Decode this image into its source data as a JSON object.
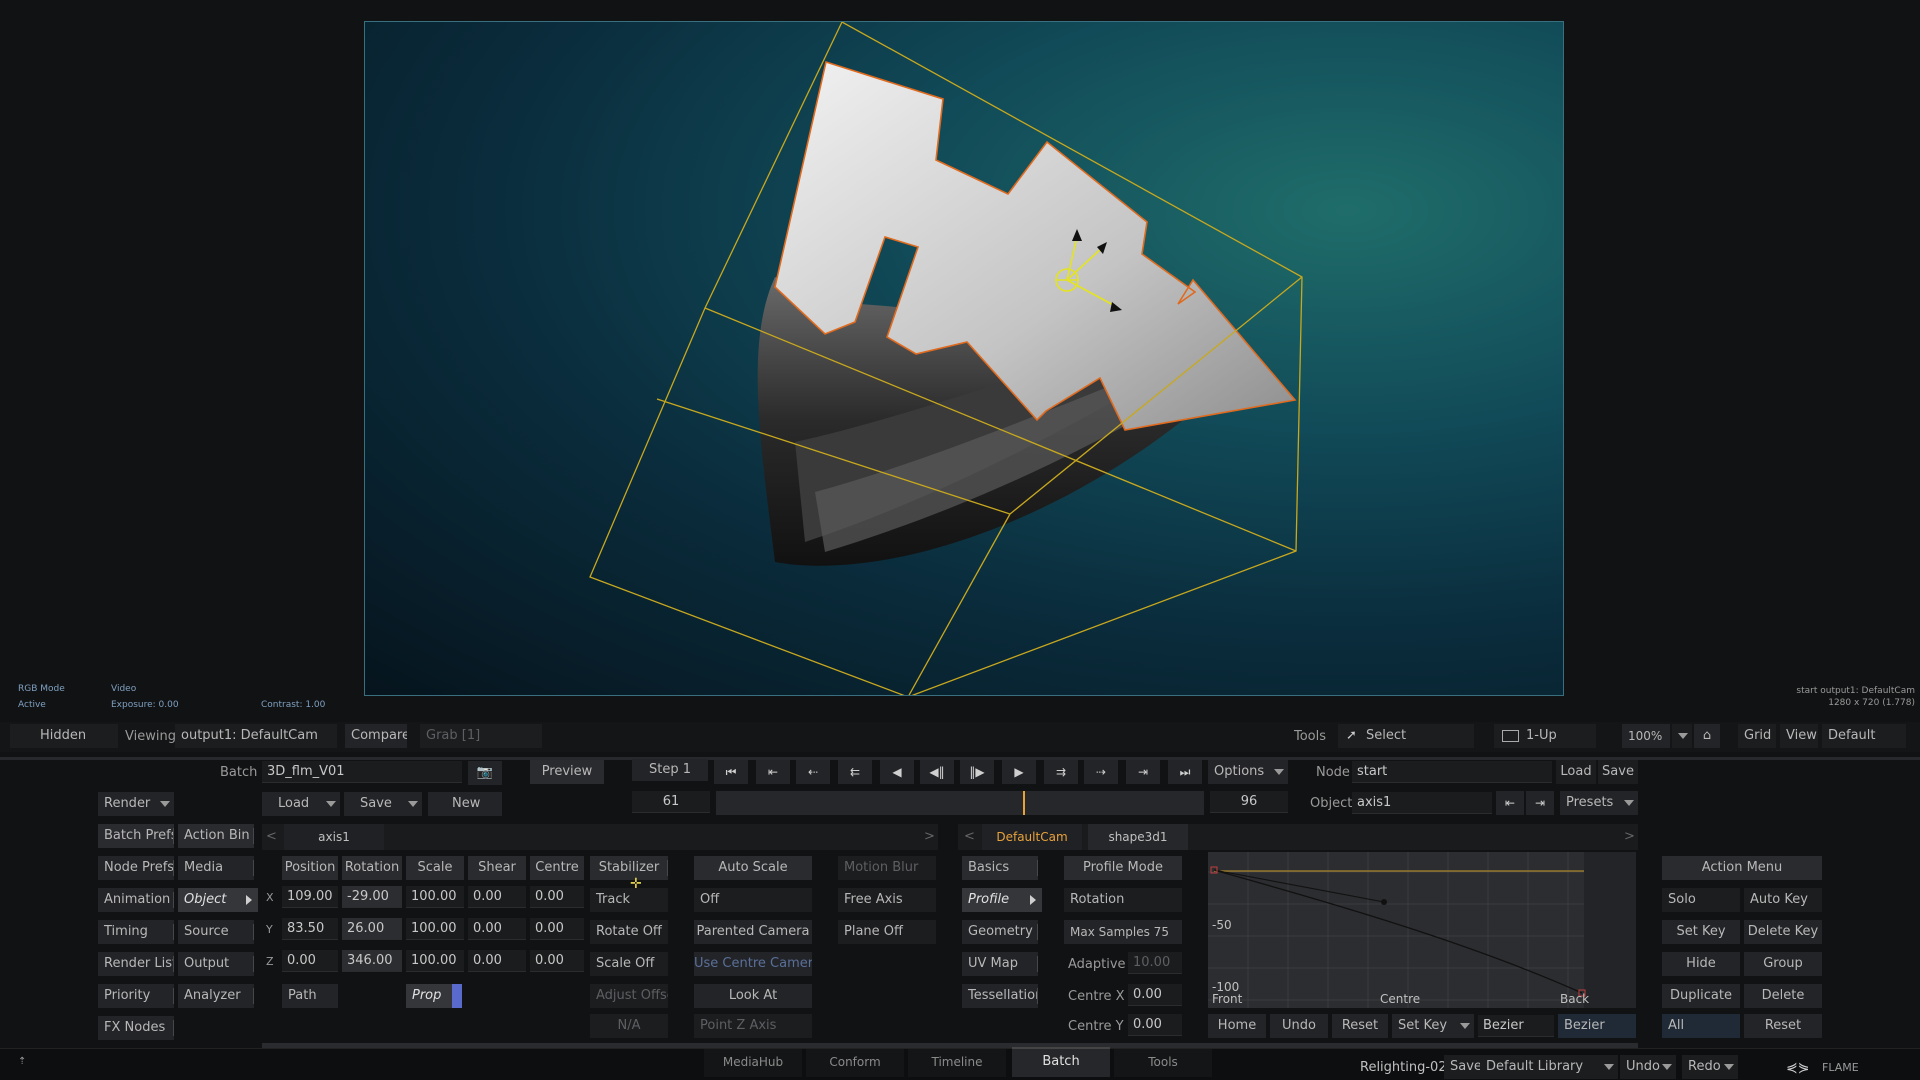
{
  "viewer": {
    "info_left": {
      "rgb_mode": "RGB Mode",
      "active": "Active",
      "video": "Video",
      "exposure": "Exposure: 0.00",
      "contrast": "Contrast: 1.00"
    },
    "info_right": {
      "line1": "start output1: DefaultCam",
      "line2": "1280 x 720 (1.778)"
    }
  },
  "viewbar": {
    "hidden": "Hidden",
    "viewing_label": "Viewing",
    "viewing_value": "output1: DefaultCam",
    "compare": "Compare",
    "grab": "Grab [1]",
    "tools_label": "Tools",
    "select": "Select",
    "layout": "1-Up",
    "zoom": "100%",
    "grid": "Grid",
    "view": "View",
    "default": "Default"
  },
  "batch": {
    "batch_label": "Batch",
    "batch_name": "3D_flm_V01",
    "preview": "Preview",
    "render": "Render",
    "load": "Load",
    "save": "Save",
    "new": "New"
  },
  "transport": {
    "step": "Step 1",
    "frame_start": "61",
    "frame_end": "96",
    "options": "Options",
    "current_frame_fraction": 0.63
  },
  "node": {
    "node_label": "Node",
    "node_value": "start",
    "load": "Load",
    "save": "Save",
    "object_label": "Object",
    "object_value": "axis1",
    "presets": "Presets"
  },
  "left_menu": {
    "rows": [
      [
        "Batch Prefs",
        "Action Bin"
      ],
      [
        "Node Prefs",
        "Media"
      ],
      [
        "Animation",
        "Object"
      ],
      [
        "Timing",
        "Source"
      ],
      [
        "Render List",
        "Output"
      ],
      [
        "Priority",
        "Analyzer"
      ],
      [
        "FX Nodes",
        ""
      ]
    ]
  },
  "object_panel": {
    "tab": "axis1",
    "headers": [
      "Position",
      "Rotation",
      "Scale",
      "Shear",
      "Centre"
    ],
    "axes": [
      "X",
      "Y",
      "Z"
    ],
    "rows": [
      [
        "109.00",
        "-29.00",
        "100.00",
        "0.00",
        "0.00"
      ],
      [
        "83.50",
        "26.00",
        "100.00",
        "0.00",
        "0.00"
      ],
      [
        "0.00",
        "346.00",
        "100.00",
        "0.00",
        "0.00"
      ]
    ],
    "path": "Path",
    "prop": "Prop",
    "stabilizer": "Stabilizer",
    "track": "Track",
    "rotate_off": "Rotate Off",
    "scale_off": "Scale Off",
    "adjust_offset": "Adjust Offset",
    "na": "N/A"
  },
  "camera_panel": {
    "auto_scale": "Auto Scale",
    "off": "Off",
    "parented_camera": "Parented Camera",
    "use_centre_camera": "Use Centre Camera",
    "look_at": "Look At",
    "point_z_axis": "Point Z Axis",
    "motion_blur": "Motion Blur",
    "free_axis": "Free Axis",
    "plane_off": "Plane Off"
  },
  "shape_panel": {
    "tabs": [
      "DefaultCam",
      "shape3d1"
    ],
    "menu": [
      "Basics",
      "Profile",
      "Geometry",
      "UV Map",
      "Tessellation"
    ],
    "profile_mode": "Profile Mode",
    "rotation": "Rotation",
    "max_samples": "Max Samples 75",
    "adaptive_label": "Adaptive",
    "adaptive_value": "10.00",
    "centre_x_label": "Centre X",
    "centre_x_value": "0.00",
    "centre_y_label": "Centre Y",
    "centre_y_value": "0.00"
  },
  "curve": {
    "label_50": "-50",
    "label_100": "-100",
    "front": "Front",
    "centre": "Centre",
    "back": "Back",
    "home": "Home",
    "undo": "Undo",
    "reset": "Reset",
    "set_key": "Set Key",
    "bezier1": "Bezier",
    "bezier2": "Bezier"
  },
  "action_menu": {
    "title": "Action Menu",
    "rows": [
      [
        "Solo",
        "Auto Key"
      ],
      [
        "Set Key",
        "Delete Key"
      ],
      [
        "Hide",
        "Group"
      ],
      [
        "Duplicate",
        "Delete"
      ],
      [
        "All",
        "Reset"
      ]
    ]
  },
  "footer": {
    "tabs": [
      "MediaHub",
      "Conform",
      "Timeline",
      "Batch",
      "Tools"
    ],
    "active_tab": "Batch",
    "project": "Relighting-02",
    "save": "Save",
    "library": "Default Library",
    "undo": "Undo",
    "redo": "Redo",
    "brand": "FLAME"
  },
  "colors": {
    "accent": "#e8a23a",
    "bbox": "#c8a81e",
    "active_tab": "#e8a23a",
    "bg": "#111214"
  }
}
